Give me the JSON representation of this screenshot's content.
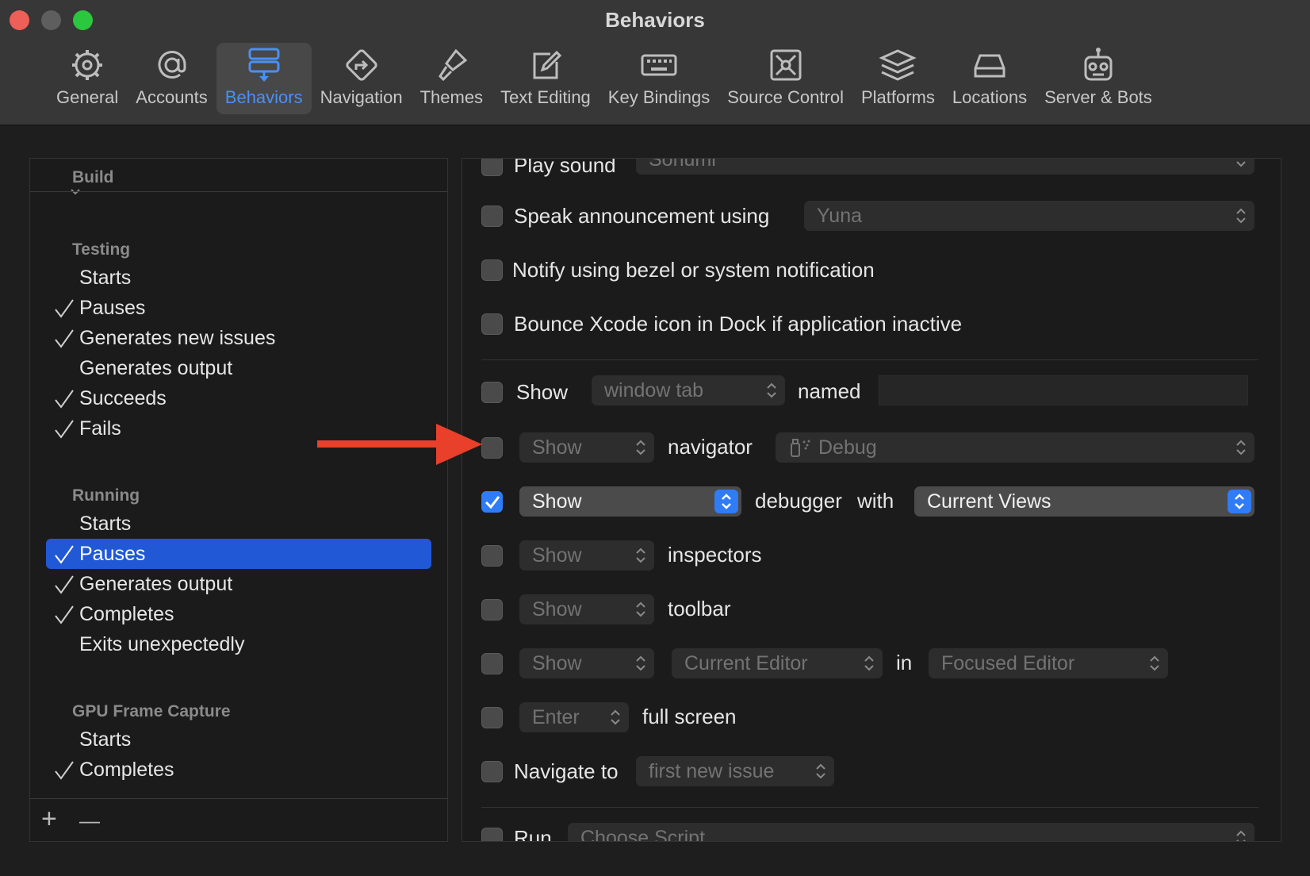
{
  "window": {
    "title": "Behaviors"
  },
  "toolbar": {
    "tabs": [
      {
        "label": "General",
        "icon": "gear-icon"
      },
      {
        "label": "Accounts",
        "icon": "at-sign-icon"
      },
      {
        "label": "Behaviors",
        "icon": "behaviors-icon",
        "active": true
      },
      {
        "label": "Navigation",
        "icon": "navigation-icon"
      },
      {
        "label": "Themes",
        "icon": "brush-icon"
      },
      {
        "label": "Text Editing",
        "icon": "pencil-square-icon"
      },
      {
        "label": "Key Bindings",
        "icon": "keyboard-icon"
      },
      {
        "label": "Source Control",
        "icon": "source-control-icon"
      },
      {
        "label": "Platforms",
        "icon": "stack-icon"
      },
      {
        "label": "Locations",
        "icon": "drive-icon"
      },
      {
        "label": "Server & Bots",
        "icon": "robot-icon"
      }
    ]
  },
  "sidebar": {
    "groups": [
      {
        "title": "Build"
      },
      {
        "title": "Testing",
        "items": [
          {
            "label": "Starts",
            "checked": false
          },
          {
            "label": "Pauses",
            "checked": true
          },
          {
            "label": "Generates new issues",
            "checked": true
          },
          {
            "label": "Generates output",
            "checked": false
          },
          {
            "label": "Succeeds",
            "checked": true
          },
          {
            "label": "Fails",
            "checked": true
          }
        ]
      },
      {
        "title": "Running",
        "items": [
          {
            "label": "Starts",
            "checked": false
          },
          {
            "label": "Pauses",
            "checked": true,
            "selected": true
          },
          {
            "label": "Generates output",
            "checked": true
          },
          {
            "label": "Completes",
            "checked": true
          },
          {
            "label": "Exits unexpectedly",
            "checked": false
          }
        ]
      },
      {
        "title": "GPU Frame Capture",
        "items": [
          {
            "label": "Starts",
            "checked": false
          },
          {
            "label": "Completes",
            "checked": true
          }
        ]
      }
    ],
    "footer": {
      "add": "+",
      "remove": "—"
    }
  },
  "main": {
    "play_sound": {
      "label": "Play sound",
      "value": "Sonumi"
    },
    "speak": {
      "label": "Speak announcement using",
      "value": "Yuna"
    },
    "notify": {
      "label": "Notify using bezel or system notification"
    },
    "bounce": {
      "label": "Bounce Xcode icon in Dock if application inactive"
    },
    "show_tab": {
      "label": "Show",
      "value": "window tab",
      "named": "named",
      "name_value": ""
    },
    "navigator": {
      "action": "Show",
      "label": "navigator",
      "value": "Debug"
    },
    "debugger": {
      "action": "Show",
      "label": "debugger",
      "with": "with",
      "value": "Current Views",
      "checked": true
    },
    "inspectors": {
      "action": "Show",
      "label": "inspectors"
    },
    "toolbar_row": {
      "action": "Show",
      "label": "toolbar"
    },
    "editor": {
      "action": "Show",
      "value": "Current Editor",
      "in": "in",
      "target": "Focused Editor"
    },
    "fullscreen": {
      "action": "Enter",
      "label": "full screen"
    },
    "navigate": {
      "label": "Navigate to",
      "value": "first new issue"
    },
    "run": {
      "label": "Run",
      "value": "Choose Script"
    }
  },
  "colors": {
    "accent": "#2f7cf6",
    "selection": "#2158d6",
    "annotation_arrow": "#e8402a"
  }
}
